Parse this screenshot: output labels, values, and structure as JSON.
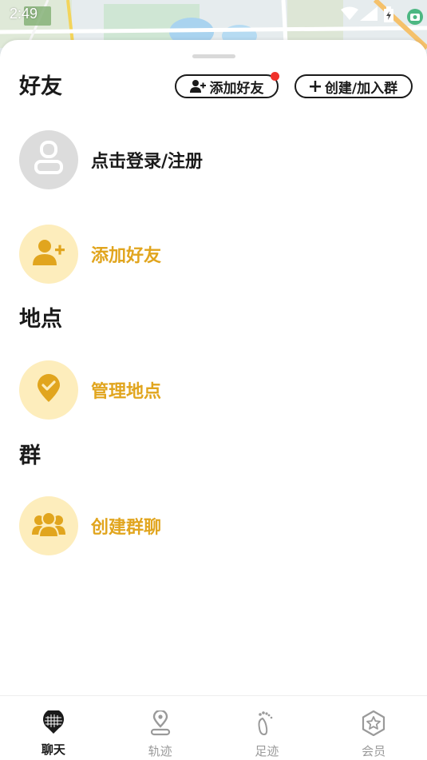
{
  "status_bar": {
    "time": "2:49"
  },
  "friends": {
    "title": "好友",
    "add_friend_button": "添加好友",
    "create_join_group_button": "创建/加入群",
    "login_row_label": "点击登录/注册",
    "add_friend_row_label": "添加好友"
  },
  "places": {
    "title": "地点",
    "manage_places_label": "管理地点"
  },
  "groups": {
    "title": "群",
    "create_group_chat_label": "创建群聊"
  },
  "bottom_nav": {
    "items": [
      {
        "label": "聊天",
        "icon": "chat-pin-icon",
        "active": true
      },
      {
        "label": "轨迹",
        "icon": "location-pin-icon",
        "active": false
      },
      {
        "label": "足迹",
        "icon": "footprints-icon",
        "active": false
      },
      {
        "label": "会员",
        "icon": "star-badge-icon",
        "active": false
      }
    ]
  },
  "colors": {
    "accent_gold": "#e1a51e",
    "accent_yellow_bg": "#fdedbc",
    "notification_red": "#f0312a",
    "text_dark": "#1a1a1a",
    "nav_inactive": "#9a9a9a"
  }
}
